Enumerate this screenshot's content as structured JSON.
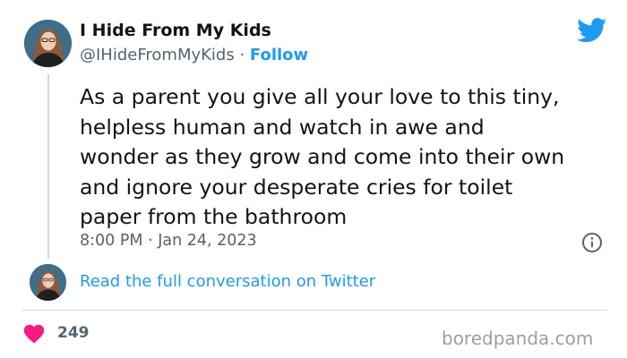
{
  "author": {
    "display_name": "I Hide From My Kids",
    "handle": "@IHideFromMyKids",
    "separator": " · ",
    "follow_label": "Follow"
  },
  "tweet": {
    "text": "As a parent you give all your love to this tiny,\nhelpless human and watch in awe and\nwonder as they grow and come into their own\nand ignore your desperate cries for toilet\npaper from the bathroom",
    "timestamp": "8:00 PM · Jan 24, 2023"
  },
  "conversation": {
    "link_label": "Read the full conversation on Twitter"
  },
  "engagement": {
    "like_count": "249"
  },
  "watermark": "boredpanda.com",
  "icons": {
    "brand": "twitter-bird-icon",
    "info": "info-icon",
    "like": "heart-icon"
  },
  "colors": {
    "accent": "#1d9bf0",
    "text": "#0f1419",
    "muted": "#536471",
    "heart": "#f91880",
    "divider": "#cfd9de"
  }
}
